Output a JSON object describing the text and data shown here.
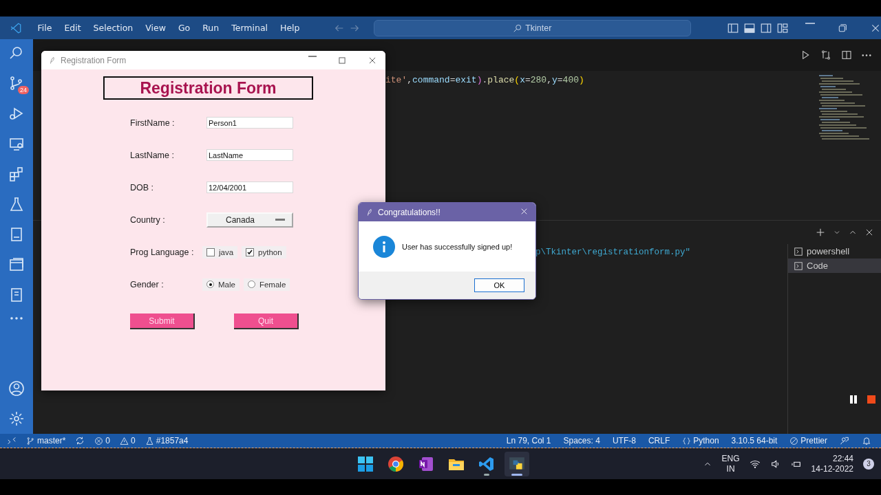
{
  "vscode": {
    "menu": [
      "File",
      "Edit",
      "Selection",
      "View",
      "Go",
      "Run",
      "Terminal",
      "Help"
    ],
    "command_center": "Tkinter",
    "source_control_badge": "24",
    "code_tokens": [
      {
        "text": "ite'",
        "kind": "string"
      },
      {
        "text": ",",
        "kind": "punct"
      },
      {
        "text": "command",
        "kind": "param"
      },
      {
        "text": "=",
        "kind": "punct"
      },
      {
        "text": "exit",
        "kind": "param"
      },
      {
        "text": ")",
        "kind": "bracket"
      },
      {
        "text": ".",
        "kind": "punct"
      },
      {
        "text": "place",
        "kind": "method"
      },
      {
        "text": "(",
        "kind": "bracket2"
      },
      {
        "text": "x",
        "kind": "param"
      },
      {
        "text": "=",
        "kind": "punct"
      },
      {
        "text": "280",
        "kind": "number"
      },
      {
        "text": ",",
        "kind": "punct"
      },
      {
        "text": "y",
        "kind": "param"
      },
      {
        "text": "=",
        "kind": "punct"
      },
      {
        "text": "400",
        "kind": "number"
      },
      {
        "text": ")",
        "kind": "bracket2"
      }
    ],
    "terminal_fragment": "p\\Tkinter\\registrationform.py\"",
    "terminals": [
      {
        "label": "powershell",
        "selected": false
      },
      {
        "label": "Code",
        "selected": true
      }
    ],
    "status_left": [
      {
        "kind": "branch",
        "text": "master*"
      },
      {
        "kind": "sync"
      },
      {
        "kind": "errors",
        "text": "0"
      },
      {
        "kind": "warnings",
        "text": "0"
      },
      {
        "kind": "commit",
        "text": "#1857a4"
      }
    ],
    "status_right": [
      {
        "kind": "plain",
        "text": "Ln 79, Col 1"
      },
      {
        "kind": "plain",
        "text": "Spaces: 4"
      },
      {
        "kind": "plain",
        "text": "UTF-8"
      },
      {
        "kind": "plain",
        "text": "CRLF"
      },
      {
        "kind": "language",
        "text": "Python"
      },
      {
        "kind": "plain",
        "text": "3.10.5 64-bit"
      },
      {
        "kind": "prettier",
        "text": "Prettier"
      },
      {
        "kind": "feedback"
      },
      {
        "kind": "bell"
      }
    ]
  },
  "registration_window": {
    "title": "Registration Form",
    "heading": "Registration Form",
    "fields": [
      {
        "label": "FirstName :",
        "value": "Person1"
      },
      {
        "label": "LastName :",
        "value": "LastName"
      },
      {
        "label": "DOB :",
        "value": "12/04/2001"
      }
    ],
    "country": {
      "label": "Country :",
      "value": "Canada"
    },
    "languages": {
      "label": "Prog Language :",
      "options": [
        {
          "label": "java",
          "checked": false
        },
        {
          "label": "python",
          "checked": true
        }
      ]
    },
    "gender": {
      "label": "Gender :",
      "options": [
        {
          "label": "Male",
          "selected": true
        },
        {
          "label": "Female",
          "selected": false
        }
      ]
    },
    "buttons": [
      "Submit",
      "Quit"
    ]
  },
  "dialog": {
    "title": "Congratulations!!",
    "message": "User has successfully signed up!",
    "button": "OK"
  },
  "taskbar": {
    "apps": [
      {
        "kind": "start",
        "running": false,
        "selected": false
      },
      {
        "kind": "browser",
        "running": false,
        "selected": false
      },
      {
        "kind": "notes",
        "running": false,
        "selected": false
      },
      {
        "kind": "folder",
        "running": false,
        "selected": false
      },
      {
        "kind": "editor",
        "running": true,
        "selected": false
      },
      {
        "kind": "python",
        "running": true,
        "selected": true
      }
    ],
    "language": [
      "ENG",
      "IN"
    ],
    "time": "22:44",
    "date": "14-12-2022",
    "notifications": "3"
  }
}
